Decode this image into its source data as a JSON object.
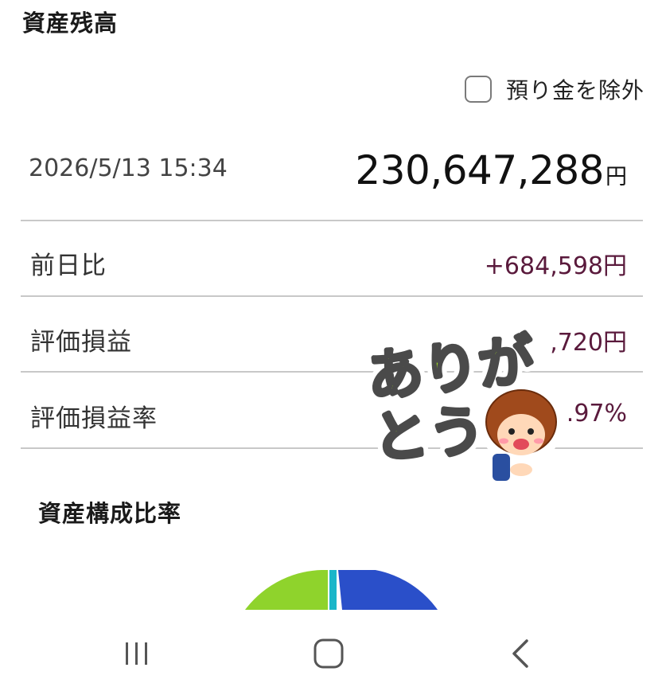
{
  "header": {
    "title": "資産残高"
  },
  "options": {
    "exclude_deposit_label": "預り金を除外",
    "exclude_deposit_checked": false
  },
  "summary": {
    "timestamp": "2026/5/13 15:34",
    "total_value": "230,647,288",
    "unit": "円"
  },
  "rows": [
    {
      "label": "前日比",
      "value": "+684,598円"
    },
    {
      "label": "評価損益",
      "value": ",720円"
    },
    {
      "label": "評価損益率",
      "value": ".97%"
    }
  ],
  "composition": {
    "title": "資産構成比率"
  },
  "sticker": {
    "line1": "ありが",
    "line2": "とう"
  },
  "colors": {
    "value_color": "#5a1a3c",
    "pie_green": "#8fd32c",
    "pie_blue": "#2a4fc9",
    "pie_cyan": "#1ab6c9",
    "sticker_green": "#9ad81f"
  },
  "nav": {
    "icons": [
      "recent-apps-icon",
      "home-icon",
      "back-icon"
    ]
  }
}
